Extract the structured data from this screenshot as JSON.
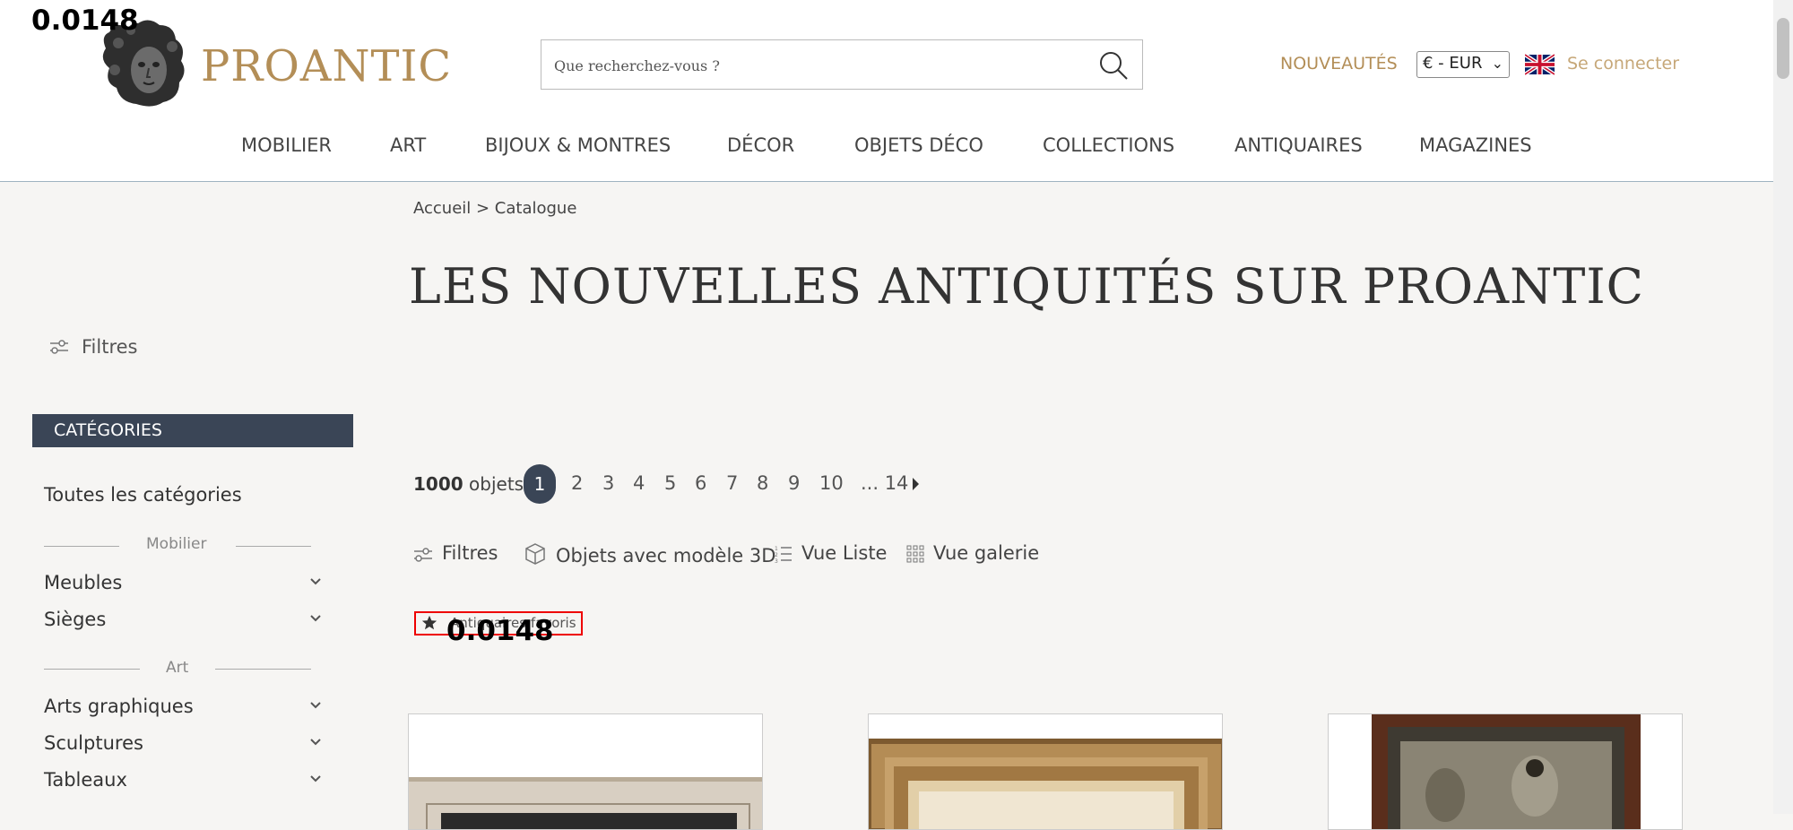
{
  "overlay": {
    "value": "0.0148"
  },
  "header": {
    "logo_text": "PROANTIC",
    "search_placeholder": "Que recherchez-vous ?",
    "nouveautes": "NOUVEAUTÉS",
    "currency": "€ - EUR",
    "login": "Se connecter"
  },
  "nav": [
    "MOBILIER",
    "ART",
    "BIJOUX & MONTRES",
    "DÉCOR",
    "OBJETS DÉCO",
    "COLLECTIONS",
    "ANTIQUAIRES",
    "MAGAZINES"
  ],
  "breadcrumb": "Accueil > Catalogue",
  "page_title": "LES NOUVELLES ANTIQUITÉS SUR PROANTIC",
  "sidebar": {
    "filters": "Filtres",
    "categories_header": "CATÉGORIES",
    "all_categories": "Toutes les catégories",
    "groups": [
      {
        "label": "Mobilier",
        "items": [
          "Meubles",
          "Sièges"
        ]
      },
      {
        "label": "Art",
        "items": [
          "Arts graphiques",
          "Sculptures",
          "Tableaux"
        ]
      }
    ]
  },
  "results": {
    "count_number": "1000",
    "count_label": "objets",
    "pages": [
      "1",
      "2",
      "3",
      "4",
      "5",
      "6",
      "7",
      "8",
      "9",
      "10",
      "... 14"
    ]
  },
  "toolbar": {
    "filters": "Filtres",
    "objects_3d": "Objets avec modèle 3D",
    "list_view": "Vue Liste",
    "gallery_view": "Vue galerie"
  },
  "favorites": {
    "label": "Antiquaires favoris",
    "overlay_value": "0.0148"
  },
  "colors": {
    "accent": "#b38e57",
    "dark": "#3a4556",
    "highlight": "#e00000"
  }
}
